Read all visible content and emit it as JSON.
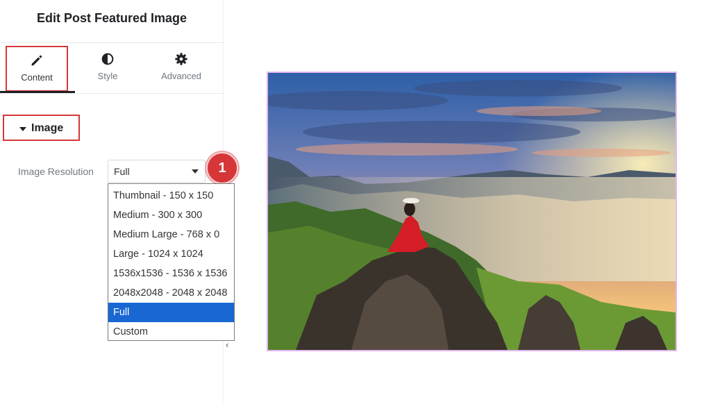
{
  "panel": {
    "title": "Edit Post Featured Image",
    "tabs": [
      {
        "label": "Content",
        "icon": "pencil-icon",
        "active": true
      },
      {
        "label": "Style",
        "icon": "half-circle-icon",
        "active": false
      },
      {
        "label": "Advanced",
        "icon": "gear-icon",
        "active": false
      }
    ],
    "section": {
      "label": "Image",
      "expanded": true
    },
    "field": {
      "label": "Image Resolution",
      "value": "Full",
      "options": [
        "Thumbnail - 150 x 150",
        "Medium - 300 x 300",
        "Medium Large - 768 x 0",
        "Large - 1024 x 1024",
        "1536x1536 - 1536 x 1536",
        "2048x2048 - 2048 x 2048",
        "Full",
        "Custom"
      ],
      "selected_index": 6
    },
    "step_badge": "1",
    "collapse_icon": "chevron-left-icon"
  },
  "preview": {
    "image": "woman-in-red-dress-on-mountain-at-sunrise"
  },
  "colors": {
    "highlight": "#d63638",
    "selected_option": "#1967d2",
    "preview_border": "#e3b8f0"
  }
}
